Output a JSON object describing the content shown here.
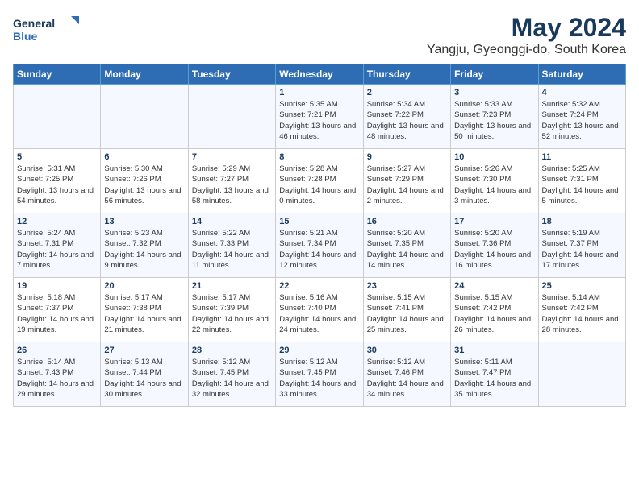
{
  "header": {
    "logo_line1": "General",
    "logo_line2": "Blue",
    "month": "May 2024",
    "location": "Yangju, Gyeonggi-do, South Korea"
  },
  "weekdays": [
    "Sunday",
    "Monday",
    "Tuesday",
    "Wednesday",
    "Thursday",
    "Friday",
    "Saturday"
  ],
  "weeks": [
    [
      {
        "day": "",
        "sunrise": "",
        "sunset": "",
        "daylight": ""
      },
      {
        "day": "",
        "sunrise": "",
        "sunset": "",
        "daylight": ""
      },
      {
        "day": "",
        "sunrise": "",
        "sunset": "",
        "daylight": ""
      },
      {
        "day": "1",
        "sunrise": "Sunrise: 5:35 AM",
        "sunset": "Sunset: 7:21 PM",
        "daylight": "Daylight: 13 hours and 46 minutes."
      },
      {
        "day": "2",
        "sunrise": "Sunrise: 5:34 AM",
        "sunset": "Sunset: 7:22 PM",
        "daylight": "Daylight: 13 hours and 48 minutes."
      },
      {
        "day": "3",
        "sunrise": "Sunrise: 5:33 AM",
        "sunset": "Sunset: 7:23 PM",
        "daylight": "Daylight: 13 hours and 50 minutes."
      },
      {
        "day": "4",
        "sunrise": "Sunrise: 5:32 AM",
        "sunset": "Sunset: 7:24 PM",
        "daylight": "Daylight: 13 hours and 52 minutes."
      }
    ],
    [
      {
        "day": "5",
        "sunrise": "Sunrise: 5:31 AM",
        "sunset": "Sunset: 7:25 PM",
        "daylight": "Daylight: 13 hours and 54 minutes."
      },
      {
        "day": "6",
        "sunrise": "Sunrise: 5:30 AM",
        "sunset": "Sunset: 7:26 PM",
        "daylight": "Daylight: 13 hours and 56 minutes."
      },
      {
        "day": "7",
        "sunrise": "Sunrise: 5:29 AM",
        "sunset": "Sunset: 7:27 PM",
        "daylight": "Daylight: 13 hours and 58 minutes."
      },
      {
        "day": "8",
        "sunrise": "Sunrise: 5:28 AM",
        "sunset": "Sunset: 7:28 PM",
        "daylight": "Daylight: 14 hours and 0 minutes."
      },
      {
        "day": "9",
        "sunrise": "Sunrise: 5:27 AM",
        "sunset": "Sunset: 7:29 PM",
        "daylight": "Daylight: 14 hours and 2 minutes."
      },
      {
        "day": "10",
        "sunrise": "Sunrise: 5:26 AM",
        "sunset": "Sunset: 7:30 PM",
        "daylight": "Daylight: 14 hours and 3 minutes."
      },
      {
        "day": "11",
        "sunrise": "Sunrise: 5:25 AM",
        "sunset": "Sunset: 7:31 PM",
        "daylight": "Daylight: 14 hours and 5 minutes."
      }
    ],
    [
      {
        "day": "12",
        "sunrise": "Sunrise: 5:24 AM",
        "sunset": "Sunset: 7:31 PM",
        "daylight": "Daylight: 14 hours and 7 minutes."
      },
      {
        "day": "13",
        "sunrise": "Sunrise: 5:23 AM",
        "sunset": "Sunset: 7:32 PM",
        "daylight": "Daylight: 14 hours and 9 minutes."
      },
      {
        "day": "14",
        "sunrise": "Sunrise: 5:22 AM",
        "sunset": "Sunset: 7:33 PM",
        "daylight": "Daylight: 14 hours and 11 minutes."
      },
      {
        "day": "15",
        "sunrise": "Sunrise: 5:21 AM",
        "sunset": "Sunset: 7:34 PM",
        "daylight": "Daylight: 14 hours and 12 minutes."
      },
      {
        "day": "16",
        "sunrise": "Sunrise: 5:20 AM",
        "sunset": "Sunset: 7:35 PM",
        "daylight": "Daylight: 14 hours and 14 minutes."
      },
      {
        "day": "17",
        "sunrise": "Sunrise: 5:20 AM",
        "sunset": "Sunset: 7:36 PM",
        "daylight": "Daylight: 14 hours and 16 minutes."
      },
      {
        "day": "18",
        "sunrise": "Sunrise: 5:19 AM",
        "sunset": "Sunset: 7:37 PM",
        "daylight": "Daylight: 14 hours and 17 minutes."
      }
    ],
    [
      {
        "day": "19",
        "sunrise": "Sunrise: 5:18 AM",
        "sunset": "Sunset: 7:37 PM",
        "daylight": "Daylight: 14 hours and 19 minutes."
      },
      {
        "day": "20",
        "sunrise": "Sunrise: 5:17 AM",
        "sunset": "Sunset: 7:38 PM",
        "daylight": "Daylight: 14 hours and 21 minutes."
      },
      {
        "day": "21",
        "sunrise": "Sunrise: 5:17 AM",
        "sunset": "Sunset: 7:39 PM",
        "daylight": "Daylight: 14 hours and 22 minutes."
      },
      {
        "day": "22",
        "sunrise": "Sunrise: 5:16 AM",
        "sunset": "Sunset: 7:40 PM",
        "daylight": "Daylight: 14 hours and 24 minutes."
      },
      {
        "day": "23",
        "sunrise": "Sunrise: 5:15 AM",
        "sunset": "Sunset: 7:41 PM",
        "daylight": "Daylight: 14 hours and 25 minutes."
      },
      {
        "day": "24",
        "sunrise": "Sunrise: 5:15 AM",
        "sunset": "Sunset: 7:42 PM",
        "daylight": "Daylight: 14 hours and 26 minutes."
      },
      {
        "day": "25",
        "sunrise": "Sunrise: 5:14 AM",
        "sunset": "Sunset: 7:42 PM",
        "daylight": "Daylight: 14 hours and 28 minutes."
      }
    ],
    [
      {
        "day": "26",
        "sunrise": "Sunrise: 5:14 AM",
        "sunset": "Sunset: 7:43 PM",
        "daylight": "Daylight: 14 hours and 29 minutes."
      },
      {
        "day": "27",
        "sunrise": "Sunrise: 5:13 AM",
        "sunset": "Sunset: 7:44 PM",
        "daylight": "Daylight: 14 hours and 30 minutes."
      },
      {
        "day": "28",
        "sunrise": "Sunrise: 5:12 AM",
        "sunset": "Sunset: 7:45 PM",
        "daylight": "Daylight: 14 hours and 32 minutes."
      },
      {
        "day": "29",
        "sunrise": "Sunrise: 5:12 AM",
        "sunset": "Sunset: 7:45 PM",
        "daylight": "Daylight: 14 hours and 33 minutes."
      },
      {
        "day": "30",
        "sunrise": "Sunrise: 5:12 AM",
        "sunset": "Sunset: 7:46 PM",
        "daylight": "Daylight: 14 hours and 34 minutes."
      },
      {
        "day": "31",
        "sunrise": "Sunrise: 5:11 AM",
        "sunset": "Sunset: 7:47 PM",
        "daylight": "Daylight: 14 hours and 35 minutes."
      },
      {
        "day": "",
        "sunrise": "",
        "sunset": "",
        "daylight": ""
      }
    ]
  ]
}
